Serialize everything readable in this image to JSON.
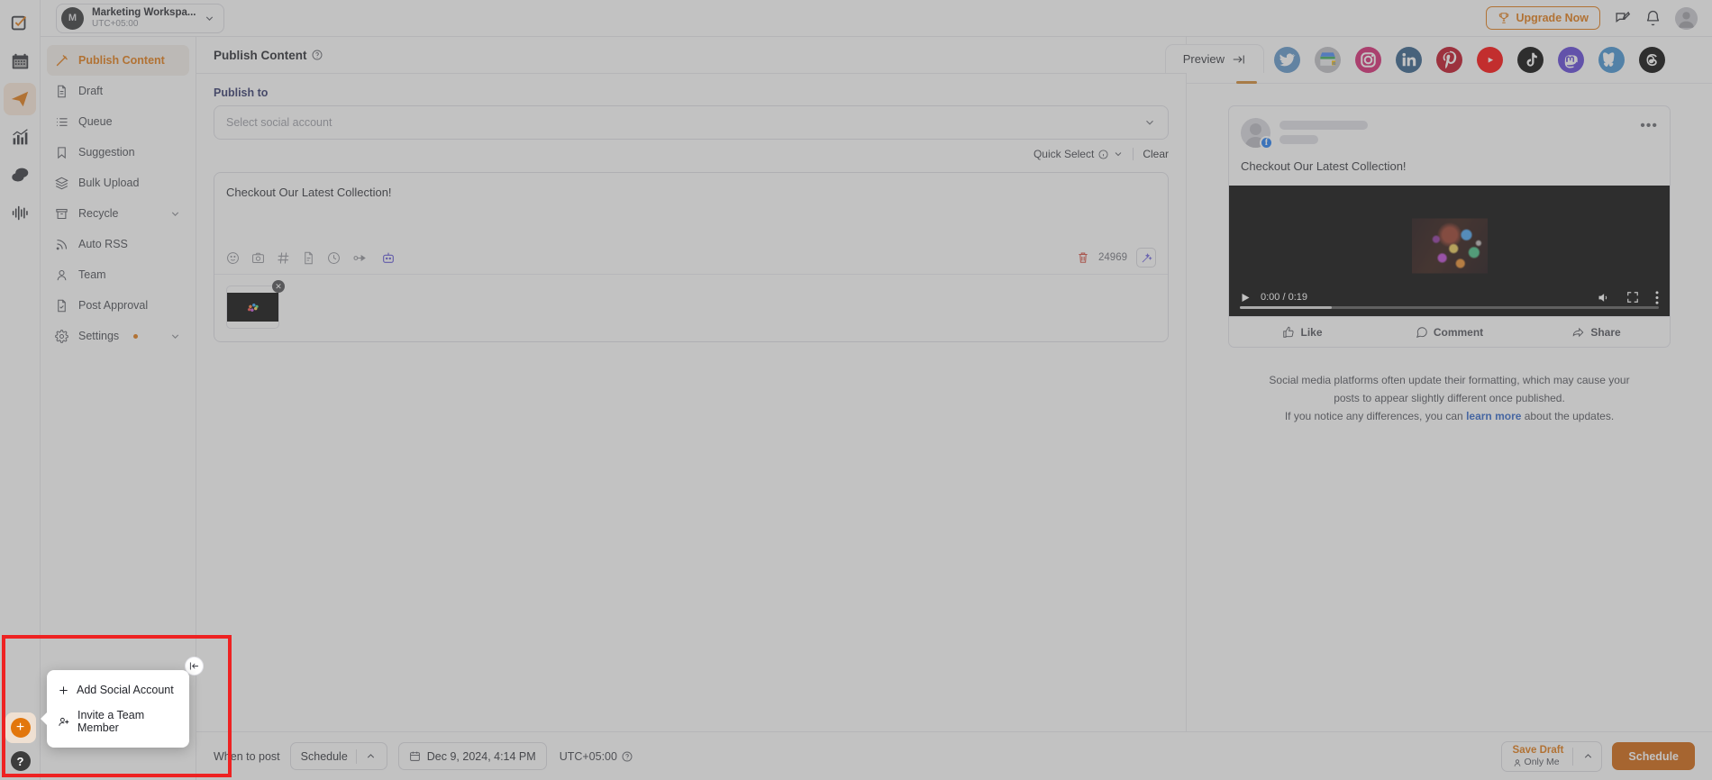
{
  "app": {
    "rail_items": [
      {
        "name": "tasks-icon",
        "label": "Tasks"
      },
      {
        "name": "calendar-icon",
        "label": "Calendar"
      },
      {
        "name": "publish-icon",
        "label": "Publish"
      },
      {
        "name": "analytics-icon",
        "label": "Analytics"
      },
      {
        "name": "inbox-icon",
        "label": "Inbox"
      },
      {
        "name": "listening-icon",
        "label": "Social Listening"
      }
    ]
  },
  "topbar": {
    "workspace_name": "Marketing Workspa...",
    "workspace_tz": "UTC+05:00",
    "workspace_initial": "M",
    "upgrade_label": "Upgrade Now",
    "trophy_icon": "trophy-icon",
    "feedback_icon": "feedback-icon",
    "bell_icon": "notification-bell-icon",
    "avatar_icon": "user-avatar"
  },
  "sidebar": {
    "items": [
      {
        "label": "Publish Content",
        "icon": "pencil-icon",
        "active": true,
        "chevron": false,
        "dot": false
      },
      {
        "label": "Draft",
        "icon": "document-icon",
        "active": false,
        "chevron": false,
        "dot": false
      },
      {
        "label": "Queue",
        "icon": "list-icon",
        "active": false,
        "chevron": false,
        "dot": false
      },
      {
        "label": "Suggestion",
        "icon": "bookmark-icon",
        "active": false,
        "chevron": false,
        "dot": false
      },
      {
        "label": "Bulk Upload",
        "icon": "layers-icon",
        "active": false,
        "chevron": false,
        "dot": false
      },
      {
        "label": "Recycle",
        "icon": "archive-icon",
        "active": false,
        "chevron": true,
        "dot": false
      },
      {
        "label": "Auto RSS",
        "icon": "rss-icon",
        "active": false,
        "chevron": false,
        "dot": false
      },
      {
        "label": "Team",
        "icon": "user-icon",
        "active": false,
        "chevron": false,
        "dot": false
      },
      {
        "label": "Post Approval",
        "icon": "file-check-icon",
        "active": false,
        "chevron": false,
        "dot": false
      },
      {
        "label": "Settings",
        "icon": "gear-icon",
        "active": false,
        "chevron": true,
        "dot": true
      }
    ]
  },
  "main": {
    "title": "Publish Content",
    "help_icon": "help-circle-icon",
    "preview_tab_label": "Preview",
    "preview_tab_icon": "arrow-to-right-icon",
    "publish_to_label": "Publish to",
    "account_select_placeholder": "Select social account",
    "quick_select_label": "Quick Select",
    "quick_select_info_icon": "info-circle-icon",
    "clear_label": "Clear",
    "compose_text": "Checkout Our Latest Collection!",
    "toolbar_icons": [
      "emoji-icon",
      "image-upload-icon",
      "hashtag-icon",
      "template-icon",
      "history-icon",
      "link-shortener-icon",
      "ai-assistant-icon"
    ],
    "delete_icon": "trash-icon",
    "char_count": "24969",
    "magic_icon": "magic-wand-icon",
    "attachment_close_icon": "close-icon"
  },
  "preview": {
    "platforms": [
      {
        "name": "facebook",
        "label": "Facebook",
        "selected": true
      },
      {
        "name": "twitter",
        "label": "Twitter",
        "selected": false
      },
      {
        "name": "gmb",
        "label": "Google Business Profile",
        "selected": false
      },
      {
        "name": "instagram",
        "label": "Instagram",
        "selected": false
      },
      {
        "name": "linkedin",
        "label": "LinkedIn",
        "selected": false
      },
      {
        "name": "pinterest",
        "label": "Pinterest",
        "selected": false
      },
      {
        "name": "youtube",
        "label": "YouTube",
        "selected": false
      },
      {
        "name": "tiktok",
        "label": "TikTok",
        "selected": false
      },
      {
        "name": "mastodon",
        "label": "Mastodon",
        "selected": false
      },
      {
        "name": "bluesky",
        "label": "Bluesky",
        "selected": false
      },
      {
        "name": "threads",
        "label": "Threads",
        "selected": false
      }
    ],
    "post_text": "Checkout Our Latest Collection!",
    "more_icon": "more-options-icon",
    "video": {
      "time_display": "0:00 / 0:19",
      "play_icon": "play-icon",
      "volume_icon": "volume-icon",
      "fullscreen_icon": "fullscreen-icon",
      "menu_icon": "video-menu-icon"
    },
    "actions": [
      {
        "label": "Like",
        "icon": "thumbs-up-icon"
      },
      {
        "label": "Comment",
        "icon": "comment-icon"
      },
      {
        "label": "Share",
        "icon": "share-icon"
      }
    ],
    "disclaimer_line1": "Social media platforms often update their formatting, which may cause your",
    "disclaimer_line2": "posts to appear slightly different once published.",
    "disclaimer_line3_a": "If you notice any differences, you can ",
    "disclaimer_link": "learn more",
    "disclaimer_line3_b": " about the updates."
  },
  "bottombar": {
    "when_label": "When to post",
    "schedule_mode": "Schedule",
    "chevron_icon": "chevron-up-icon",
    "date_value": "Dec 9, 2024, 4:14 PM",
    "calendar_icon": "calendar-icon",
    "timezone": "UTC+05:00",
    "timezone_help_icon": "help-circle-icon",
    "save_draft_title": "Save Draft",
    "save_draft_sub": "Only Me",
    "save_draft_person_icon": "person-icon",
    "schedule_button": "Schedule"
  },
  "popup": {
    "items": [
      {
        "label": "Add Social Account",
        "icon": "plus-icon"
      },
      {
        "label": "Invite a Team Member",
        "icon": "user-plus-icon"
      }
    ],
    "fab_add_icon": "plus-icon",
    "fab_help_label": "?",
    "collapse_icon": "collapse-sidebar-icon"
  },
  "colors": {
    "accent": "#e2760c",
    "schedule_button": "#cf5f05",
    "section_label": "#2b3166",
    "link": "#2b62c9",
    "highlight_box": "#ee2222"
  }
}
